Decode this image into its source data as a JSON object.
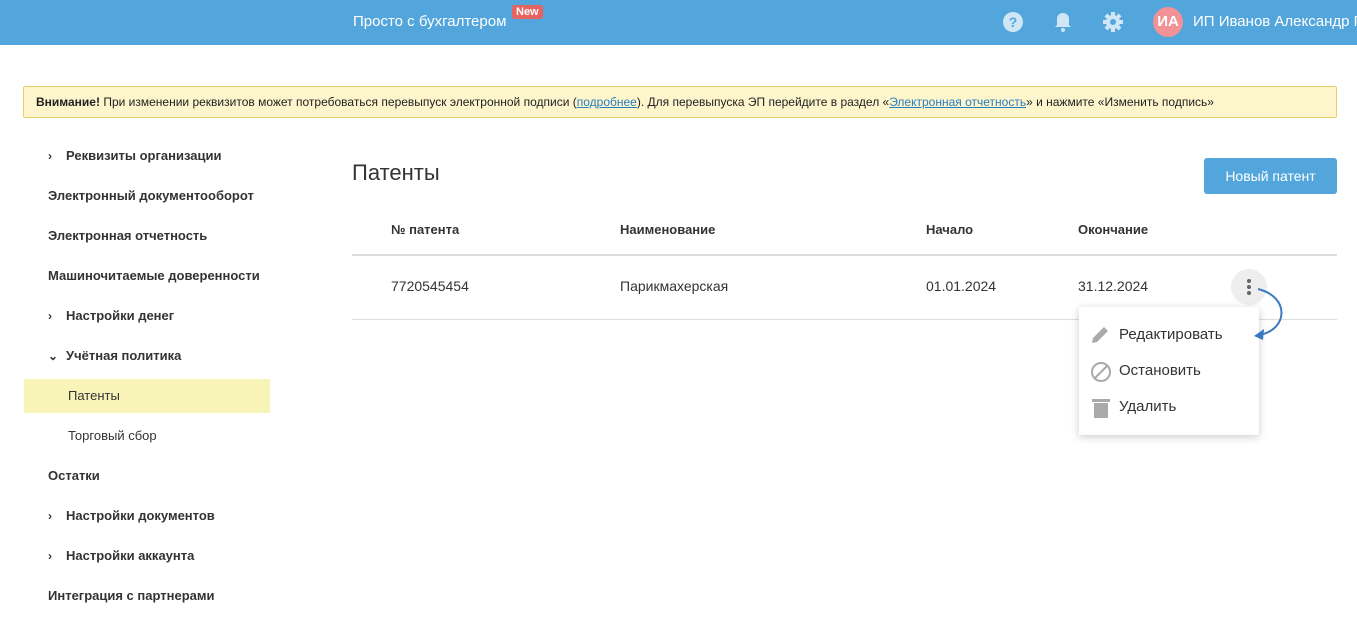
{
  "header": {
    "brand": "Просто с бухгалтером",
    "badge": "New",
    "avatar_initials": "ИА",
    "user_name": "ИП Иванов Александр Г"
  },
  "banner": {
    "bold": "Внимание!",
    "text1": " При изменении реквизитов может потребоваться перевыпуск электронной подписи (",
    "link1": "подробнее",
    "text2": "). Для перевыпуска ЭП перейдите в раздел «",
    "link2": "Электронная отчетность",
    "text3": "» и нажмите «Изменить подпись»"
  },
  "sidebar": {
    "items": [
      {
        "label": "Реквизиты организации"
      },
      {
        "label": "Электронный документооборот"
      },
      {
        "label": "Электронная отчетность"
      },
      {
        "label": "Машиночитаемые доверенности"
      },
      {
        "label": "Настройки денег"
      },
      {
        "label": "Учётная политика"
      },
      {
        "label": "Патенты"
      },
      {
        "label": "Торговый сбор"
      },
      {
        "label": "Остатки"
      },
      {
        "label": "Настройки документов"
      },
      {
        "label": "Настройки аккаунта"
      },
      {
        "label": "Интеграция с партнерами"
      }
    ]
  },
  "main": {
    "title": "Патенты",
    "new_button": "Новый патент",
    "columns": [
      "№ патента",
      "Наименование",
      "Начало",
      "Окончание"
    ],
    "rows": [
      [
        "7720545454",
        "Парикмахерская",
        "01.01.2024",
        "31.12.2024"
      ]
    ]
  },
  "menu": {
    "items": [
      "Редактировать",
      "Остановить",
      "Удалить"
    ]
  }
}
